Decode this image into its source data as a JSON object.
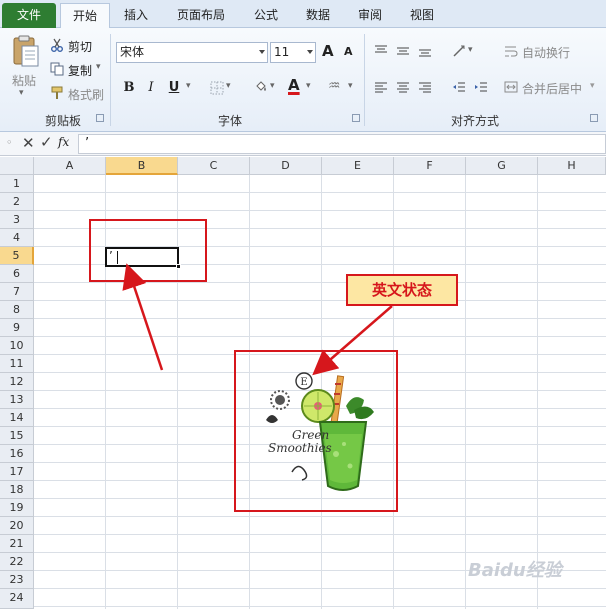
{
  "tabs": [
    {
      "label": "文件",
      "id": "file"
    },
    {
      "label": "开始",
      "id": "home"
    },
    {
      "label": "插入",
      "id": "insert"
    },
    {
      "label": "页面布局",
      "id": "layout"
    },
    {
      "label": "公式",
      "id": "formulas"
    },
    {
      "label": "数据",
      "id": "data"
    },
    {
      "label": "审阅",
      "id": "review"
    },
    {
      "label": "视图",
      "id": "view"
    }
  ],
  "ribbon": {
    "clipboard": {
      "paste": "粘贴",
      "cut": "剪切",
      "copy": "复制",
      "format_painter": "格式刷",
      "group_label": "剪贴板"
    },
    "font": {
      "font_name": "宋体",
      "font_size": "11",
      "bold": "B",
      "italic": "I",
      "underline": "U",
      "grow": "A",
      "shrink": "A",
      "group_label": "字体",
      "font_color": "#d6171c"
    },
    "alignment": {
      "wrap_text": "自动换行",
      "merge_center": "合并后居中",
      "group_label": "对齐方式"
    }
  },
  "formula_bar": {
    "fx": "fx",
    "value": "’"
  },
  "columns": [
    "A",
    "B",
    "C",
    "D",
    "E",
    "F",
    "G",
    "H"
  ],
  "rows": [
    "1",
    "2",
    "3",
    "4",
    "5",
    "6",
    "7",
    "8",
    "9",
    "10",
    "11",
    "12",
    "13",
    "14",
    "15",
    "16",
    "17",
    "18",
    "19",
    "20",
    "21",
    "22",
    "23",
    "24"
  ],
  "active_cell": {
    "column": "B",
    "row": "5",
    "value": "’"
  },
  "annotation": {
    "callout_text": "英文状态"
  },
  "image_in_sheet": {
    "title_line1": "Green",
    "title_line2": "Smoothies",
    "badge": "E"
  },
  "watermark": "Baidu经验",
  "colors": {
    "file_tab": "#2e7d32",
    "selection_header": "#f9d98f",
    "annotation_red": "#d6171c",
    "callout_fill": "#fde7a3"
  }
}
